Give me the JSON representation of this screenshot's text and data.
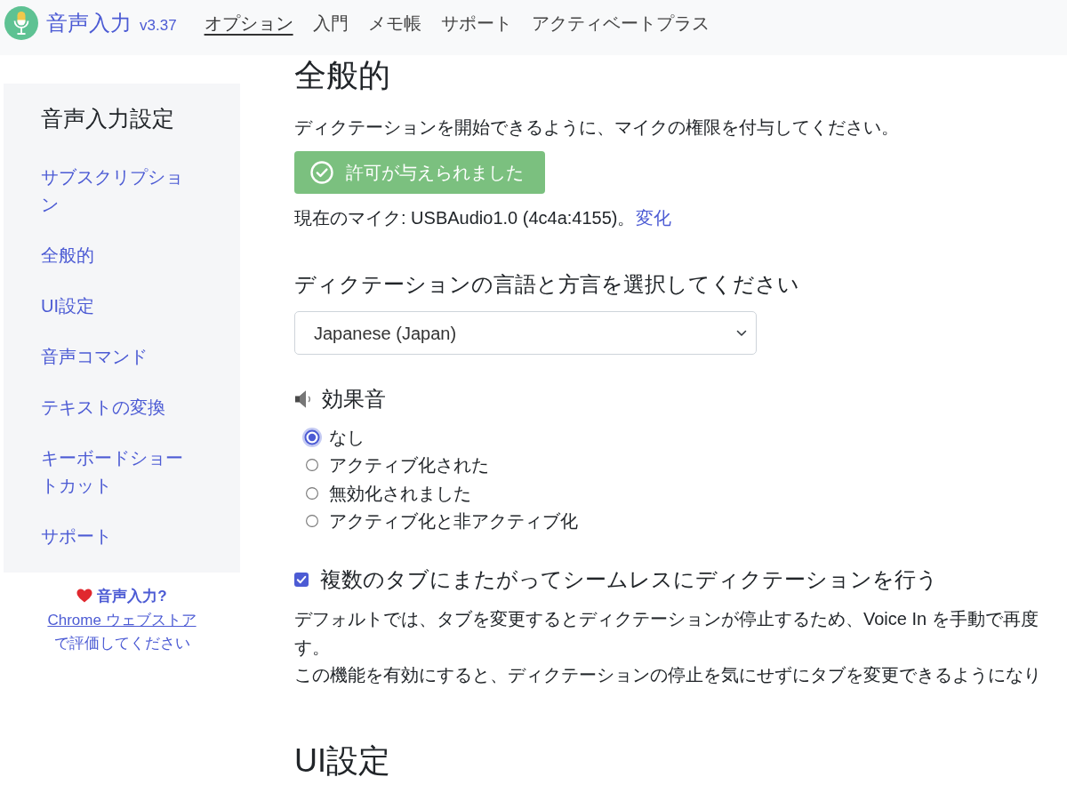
{
  "navbar": {
    "brand": "音声入力",
    "version": "v3.37",
    "links": [
      {
        "label": "オプション",
        "selected": true
      },
      {
        "label": "入門",
        "selected": false
      },
      {
        "label": "メモ帳",
        "selected": false
      },
      {
        "label": "サポート",
        "selected": false
      },
      {
        "label": "アクティベートプラス",
        "selected": false
      }
    ]
  },
  "sidebar": {
    "title": "音声入力設定",
    "items": [
      "サブスクリプション",
      "全般的",
      "UI設定",
      "音声コマンド",
      "テキストの変換",
      "キーボードショートカット",
      "サポート"
    ],
    "rating": {
      "lead": "**音声入力?**",
      "link": "Chrome ウェブストア",
      "tail": "で評価してください"
    }
  },
  "general": {
    "title": "全般的",
    "permission_text": "ディクテーションを開始できるように、マイクの権限を付与してください。",
    "permission_button": "許可が与えられました",
    "microphone": {
      "text": "現在のマイク: USBAudio1.0 (4c4a:4155)。",
      "link": "変化"
    },
    "language": {
      "label": "ディクテーションの言語と方言を選択してください",
      "value": "Japanese (Japan)"
    },
    "sound_effects": {
      "title": "効果音",
      "options": [
        {
          "label": "なし",
          "selected": true
        },
        {
          "label": "アクティブ化された",
          "selected": false
        },
        {
          "label": "無効化されました",
          "selected": false
        },
        {
          "label": "アクティブ化と非アクティブ化",
          "selected": false
        }
      ]
    },
    "seamless_tabs": {
      "label": "複数のタブにまたがってシームレスにディクテーションを行う",
      "checked": true,
      "description": [
        "デフォルトでは、タブを変更するとディクテーションが停止するため、Voice In を手動で再度",
        "す。",
        "この機能を有効にすると、ディクテーションの停止を気にせずにタブを変更できるようになり"
      ]
    }
  },
  "next_section": {
    "title": "UI設定"
  }
}
